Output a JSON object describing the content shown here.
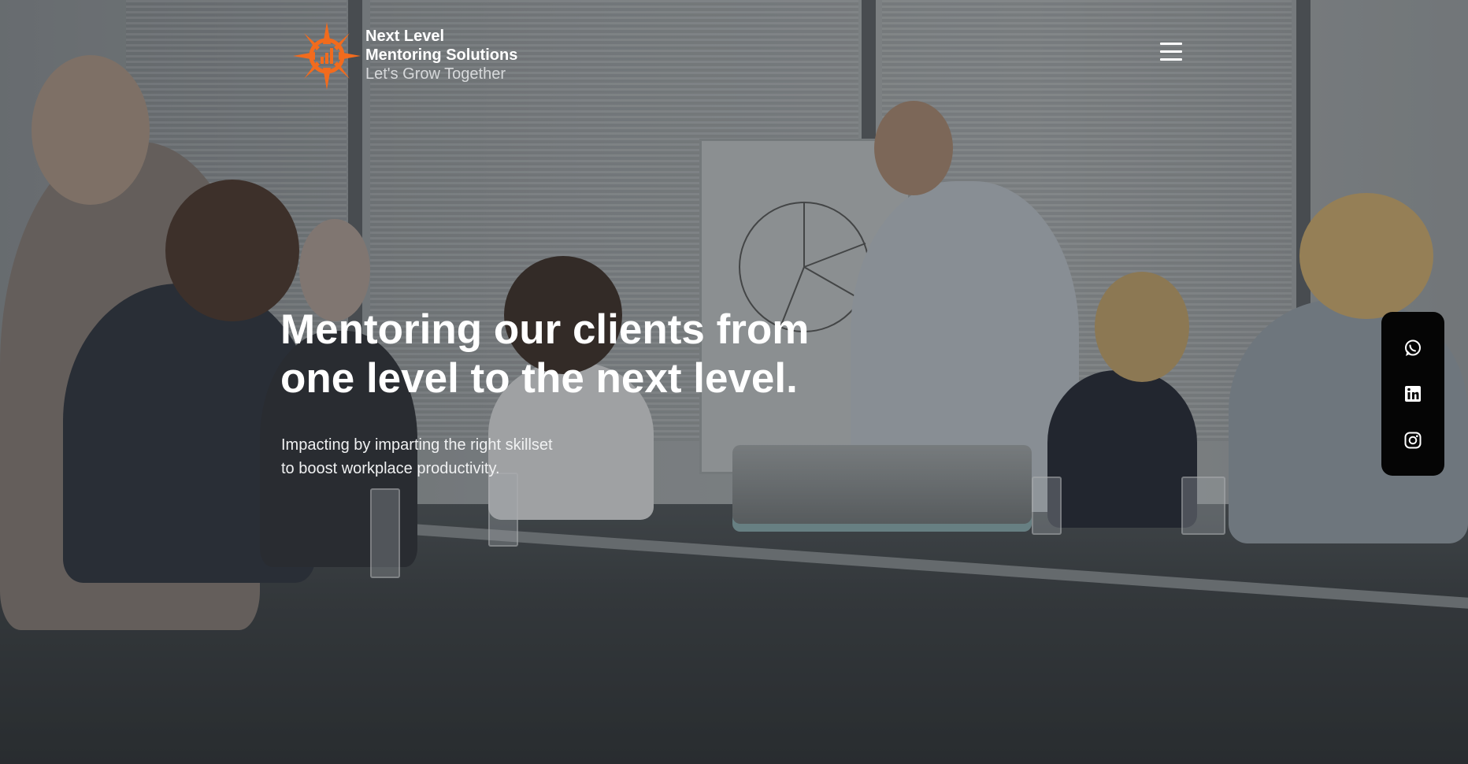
{
  "brand": {
    "line1": "Next Level",
    "line2": "Mentoring Solutions",
    "tagline": "Let's Grow Together",
    "accent_color": "#f26b1d",
    "logo_icon": "compass-chart-icon"
  },
  "nav": {
    "menu_icon": "hamburger-menu-icon"
  },
  "hero": {
    "headline_line1": "Mentoring our clients from",
    "headline_line2": "one level to the next level.",
    "subline_line1": "Impacting by imparting the right skillset",
    "subline_line2": "to boost workplace productivity."
  },
  "social": {
    "items": [
      {
        "icon": "whatsapp-icon"
      },
      {
        "icon": "linkedin-icon"
      },
      {
        "icon": "instagram-icon"
      }
    ],
    "background": "#050505"
  }
}
